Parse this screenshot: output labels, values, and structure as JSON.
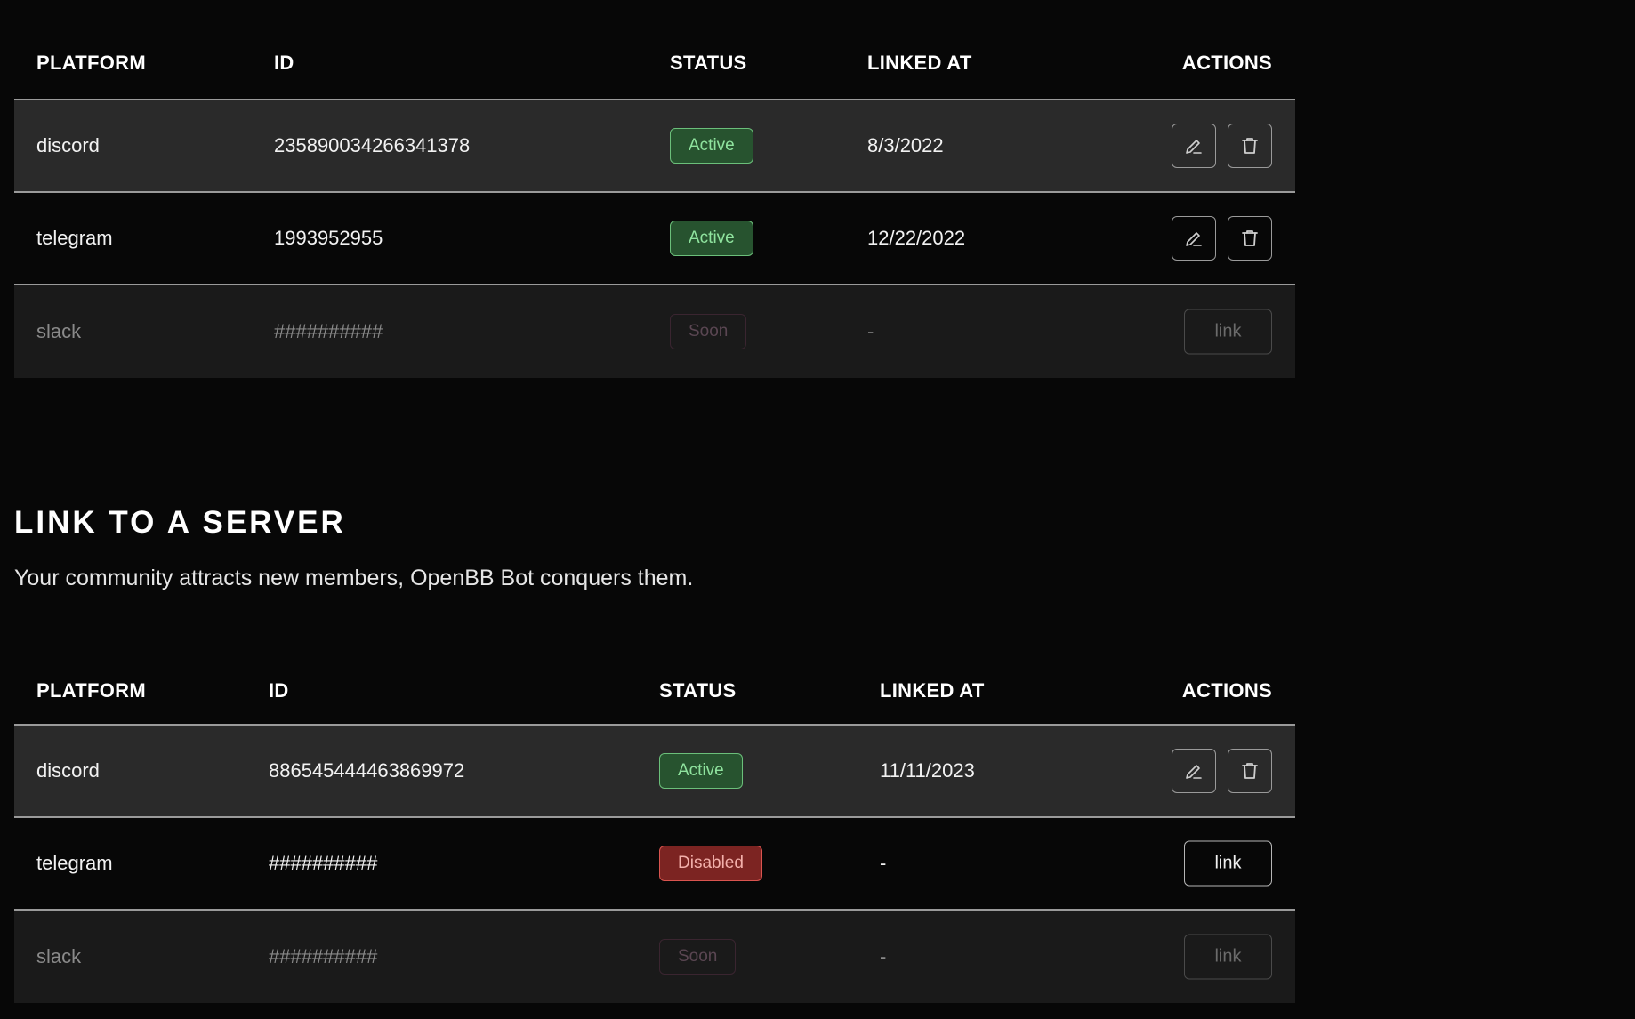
{
  "colors": {
    "background": "#070707",
    "row_highlight": "#2a2a2a",
    "row_muted": "#1a1a1a",
    "active_bg": "#27532f",
    "active_text": "#8fe39e",
    "disabled_bg": "#7c2422",
    "disabled_text": "#f3b0ab"
  },
  "table1": {
    "headers": {
      "platform": "PLATFORM",
      "id": "ID",
      "status": "STATUS",
      "linked_at": "LINKED AT",
      "actions": "ACTIONS"
    },
    "rows": [
      {
        "platform": "discord",
        "id": "235890034266341378",
        "status": "Active",
        "linked_at": "8/3/2022",
        "actions": [
          "edit-icon",
          "trash-icon"
        ]
      },
      {
        "platform": "telegram",
        "id": "1993952955",
        "status": "Active",
        "linked_at": "12/22/2022",
        "actions": [
          "edit-icon",
          "trash-icon"
        ]
      },
      {
        "platform": "slack",
        "id": "##########",
        "status": "Soon",
        "linked_at": "-",
        "action_label": "link"
      }
    ]
  },
  "section": {
    "title": "LINK TO A SERVER",
    "subtitle": "Your community attracts new members, OpenBB Bot conquers them."
  },
  "table2": {
    "headers": {
      "platform": "PLATFORM",
      "id": "ID",
      "status": "STATUS",
      "linked_at": "LINKED AT",
      "actions": "ACTIONS"
    },
    "rows": [
      {
        "platform": "discord",
        "id": "886545444463869972",
        "status": "Active",
        "linked_at": "11/11/2023",
        "actions": [
          "edit-icon",
          "trash-icon"
        ]
      },
      {
        "platform": "telegram",
        "id": "##########",
        "status": "Disabled",
        "linked_at": "-",
        "action_label": "link"
      },
      {
        "platform": "slack",
        "id": "##########",
        "status": "Soon",
        "linked_at": "-",
        "action_label": "link"
      }
    ]
  }
}
